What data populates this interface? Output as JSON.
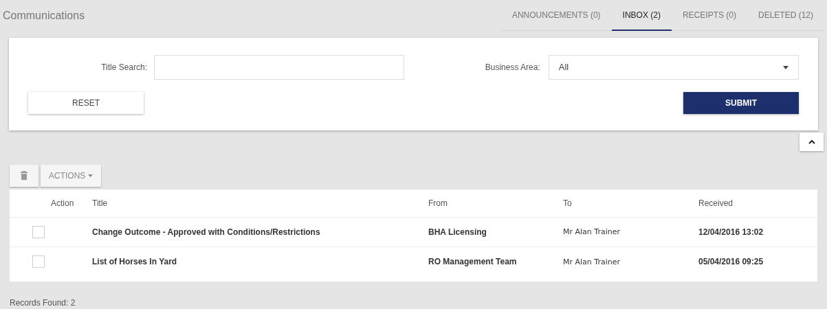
{
  "header": {
    "title": "Communications"
  },
  "tabs": [
    {
      "label": "ANNOUNCEMENTS (0)",
      "selected": false
    },
    {
      "label": "INBOX (2)",
      "selected": true
    },
    {
      "label": "RECEIPTS (0)",
      "selected": false
    },
    {
      "label": "DELETED (12)",
      "selected": false
    }
  ],
  "filters": {
    "title_search": {
      "label": "Title Search:"
    },
    "business_area": {
      "label": "Business Area:",
      "value": "All"
    },
    "reset": "RESET",
    "submit": "SUBMIT"
  },
  "toolbar": {
    "actions": "ACTIONS"
  },
  "table": {
    "columns": [
      "Action",
      "Title",
      "From",
      "To",
      "Received"
    ],
    "rows": [
      {
        "checked": false,
        "title": "Change Outcome - Approved with Conditions/Restrictions",
        "from": "BHA Licensing",
        "to": "Mr Alan Trainer",
        "received": "12/04/2016 13:02"
      },
      {
        "checked": false,
        "title": "List of Horses In Yard",
        "from": "RO Management Team",
        "to": "Mr Alan Trainer",
        "received": "05/04/2016 09:25"
      }
    ]
  },
  "status": "Records Found: 2"
}
